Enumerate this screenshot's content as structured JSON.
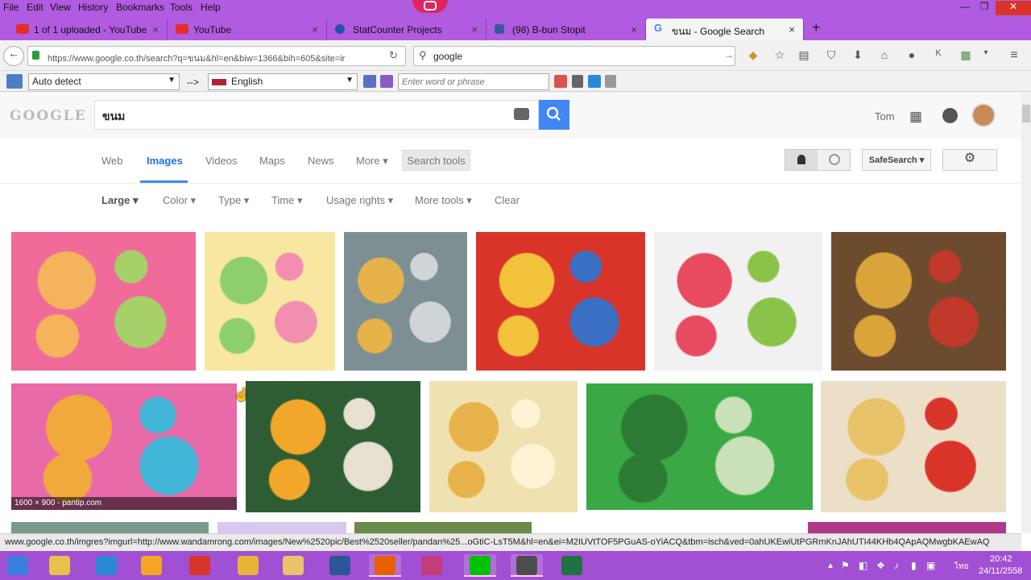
{
  "menu": [
    "File",
    "Edit",
    "View",
    "History",
    "Bookmarks",
    "Tools",
    "Help"
  ],
  "window_controls": {
    "minimize": "—",
    "maximize": "❐",
    "close": "✕"
  },
  "tabs": [
    {
      "label": "1 of 1 uploaded - YouTube",
      "favicon_color": "#e52d27"
    },
    {
      "label": "YouTube",
      "favicon_color": "#e52d27"
    },
    {
      "label": "StatCounter Projects",
      "favicon_color": "#2455a4"
    },
    {
      "label": "(98) B-bun Stopit",
      "favicon_color": "#3b5998"
    },
    {
      "label": "ขนม - Google Search",
      "favicon_color": "#4285f4"
    }
  ],
  "tab_close": "×",
  "new_tab": "+",
  "nav": {
    "url": "https://www.google.co.th/search?q=ขนม&hl=en&biw=1366&bih=605&site=ir",
    "search_value": "google"
  },
  "translator": {
    "source": "Auto detect",
    "arrow": "-->",
    "target": "English",
    "placeholder": "Enter word or phrase"
  },
  "google": {
    "logo": "GOOGLE",
    "query": "ขนม",
    "user": "Tom",
    "tabs": [
      "Web",
      "Images",
      "Videos",
      "Maps",
      "News",
      "More ▾"
    ],
    "search_tools": "Search tools",
    "safesearch": "SafeSearch ▾",
    "filters": [
      "Large ▾",
      "Color ▾",
      "Type ▾",
      "Time ▾",
      "Usage rights ▾",
      "More tools ▾",
      "Clear"
    ]
  },
  "images": [
    {
      "colors": [
        "#f06a9a",
        "#f5b35b",
        "#a6d06a"
      ],
      "caption": ""
    },
    {
      "colors": [
        "#f7e7a0",
        "#8fcf6b",
        "#f28fb0"
      ],
      "caption": ""
    },
    {
      "colors": [
        "#7e8f93",
        "#e6b24a",
        "#cfd5d6"
      ],
      "caption": ""
    },
    {
      "colors": [
        "#d9342a",
        "#f2c33b",
        "#3a6fc4"
      ],
      "caption": ""
    },
    {
      "colors": [
        "#f1f1f1",
        "#e84a5f",
        "#8bc34a"
      ],
      "caption": ""
    },
    {
      "colors": [
        "#6d4b2e",
        "#d9a43a",
        "#c0392b"
      ],
      "caption": ""
    },
    {
      "colors": [
        "#e86aa8",
        "#f2a93b",
        "#42b6d8"
      ],
      "caption": "1600 × 900 - pantip.com"
    },
    {
      "colors": [
        "#2f5d33",
        "#f2a72a",
        "#e8e0d0"
      ],
      "caption": ""
    },
    {
      "colors": [
        "#f0e2b0",
        "#e8b34a",
        "#fff3d6"
      ],
      "caption": ""
    },
    {
      "colors": [
        "#3aa844",
        "#2c7a33",
        "#c9e0b8"
      ],
      "caption": ""
    },
    {
      "colors": [
        "#ecdfc8",
        "#e8c36a",
        "#d9342a"
      ],
      "caption": ""
    }
  ],
  "status_url": "www.google.co.th/imgres?imgurl=http://www.wandamrong.com/images/New%2520pic/Best%2520seller/pandan%25...oGtiC-LsT5M&hl=en&ei=M2IUVtTOF5PGuAS-oYiACQ&tbm=isch&ved=0ahUKEwiUtPGRmKnJAhUTI44KHb4QApAQMwgbKAEwAQ",
  "clock": {
    "time": "20:42",
    "date": "24/11/2558",
    "lang": "ไทย"
  },
  "taskbar_apps": [
    {
      "name": "windows",
      "color": "#3d7fe0"
    },
    {
      "name": "file-explorer",
      "color": "#e8c14a"
    },
    {
      "name": "media",
      "color": "#2a8ad6"
    },
    {
      "name": "app-orange",
      "color": "#f5a623"
    },
    {
      "name": "app-red",
      "color": "#d9342a"
    },
    {
      "name": "chrome",
      "color": "#e8b53a"
    },
    {
      "name": "search-app",
      "color": "#e8c36a"
    },
    {
      "name": "word",
      "color": "#2b5797"
    },
    {
      "name": "firefox",
      "color": "#e66000"
    },
    {
      "name": "app-pink",
      "color": "#c43c7a"
    },
    {
      "name": "line",
      "color": "#00c300"
    },
    {
      "name": "recorder",
      "color": "#4d4d4d"
    },
    {
      "name": "excel",
      "color": "#1f7244"
    }
  ]
}
